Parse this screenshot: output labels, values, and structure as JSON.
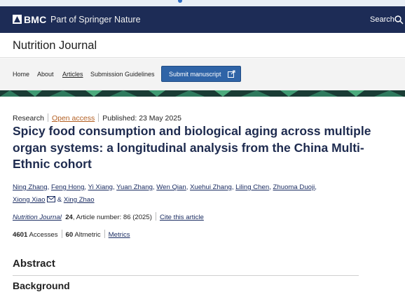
{
  "brand": {
    "name": "BMC",
    "tagline": "Part of Springer Nature",
    "search_label": "Search"
  },
  "journal": {
    "title": "Nutrition Journal"
  },
  "nav": {
    "items": [
      {
        "label": "Home"
      },
      {
        "label": "About"
      },
      {
        "label": "Articles"
      },
      {
        "label": "Submission Guidelines"
      }
    ],
    "submit_label": "Submit manuscript"
  },
  "article": {
    "type": "Research",
    "access": "Open access",
    "published": "Published: 23 May 2025",
    "title": "Spicy food consumption and biological aging across multiple organ systems: a longitudinal analysis from the China Multi-Ethnic cohort",
    "authors": [
      "Ning Zhang",
      "Feng Hong",
      "Yi Xiang",
      "Yuan Zhang",
      "Wen Qian",
      "Xuehui Zhang",
      "Liling Chen",
      "Zhuoma Duoji",
      "Xiong Xiao",
      "Xing Zhao"
    ],
    "authors_and": "&",
    "citation": {
      "journal": "Nutrition Journal",
      "volume": "24",
      "rest": ", Article number: 86 (2025)",
      "cite_label": "Cite this article"
    },
    "metrics": {
      "accesses_value": "4601",
      "accesses_label": "Accesses",
      "altmetric_value": "60",
      "altmetric_label": "Altmetric",
      "metrics_link": "Metrics"
    }
  },
  "sections": {
    "abstract": "Abstract",
    "background": "Background"
  },
  "colors": {
    "brand_bar": "#1d2c56",
    "submit_button": "#2f64a7",
    "title_text": "#1e2b4f",
    "link": "#1b2d62",
    "open_access": "#b35f22"
  }
}
